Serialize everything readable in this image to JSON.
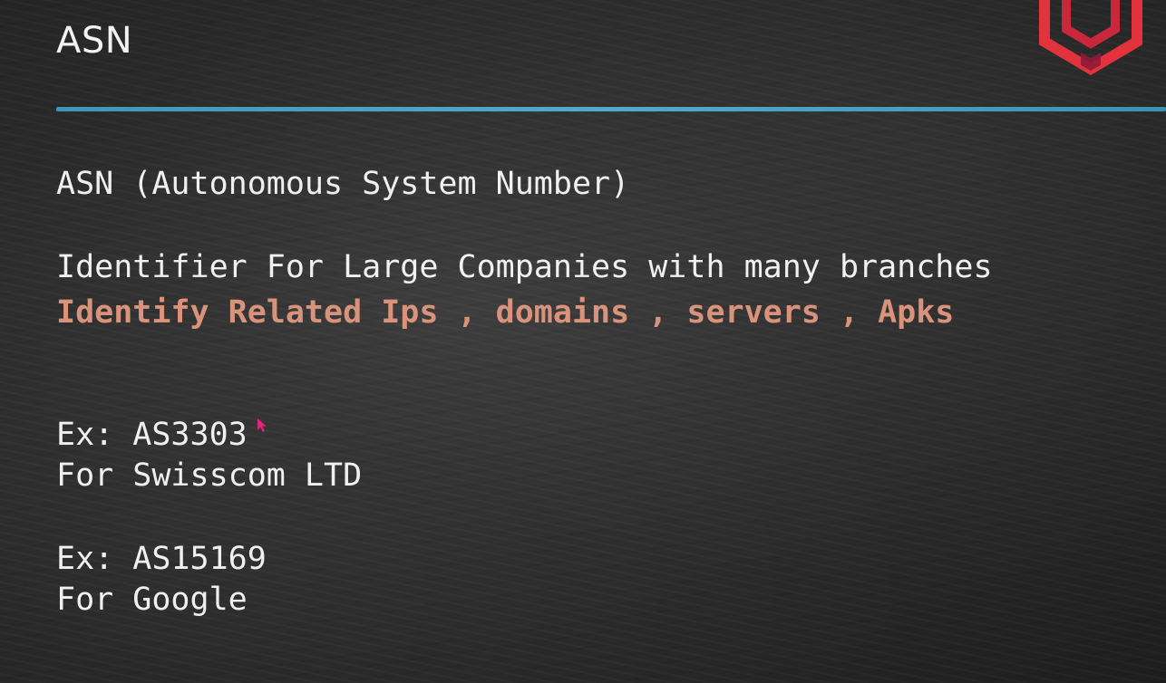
{
  "slide": {
    "title": "ASN",
    "definition": "ASN (Autonomous System Number)",
    "description": "Identifier For Large Companies with many branches",
    "highlight": "Identify Related Ips , domains , servers , Apks",
    "examples": [
      {
        "code": "Ex: AS3303",
        "owner": "For Swisscom LTD"
      },
      {
        "code": "Ex: AS15169",
        "owner": "For Google"
      }
    ]
  },
  "colors": {
    "background": "#2c2c2c",
    "rule": "#4aaed6",
    "highlight": "#d9937b",
    "logo": "#e2323c",
    "text": "#f0f0f0"
  },
  "icons": {
    "logo": "hexagon-logo-icon",
    "cursor": "mouse-pointer-icon"
  }
}
